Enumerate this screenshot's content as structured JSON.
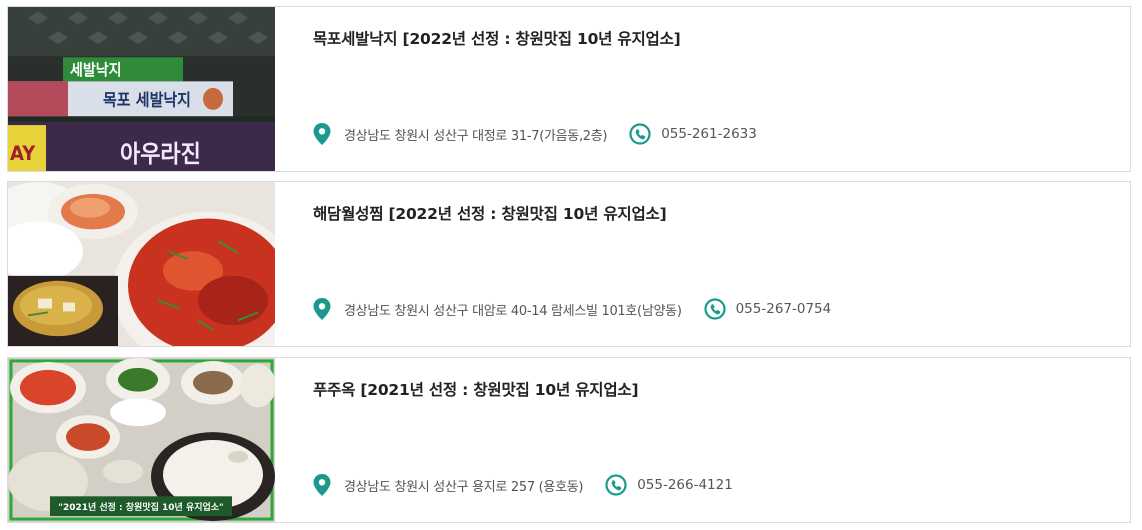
{
  "accent_color": "#1a9a8a",
  "restaurants": [
    {
      "title": "목포세발낙지 [2022년 선정 : 창원맛집 10년 유지업소]",
      "address": "경상남도 창원시 성산구 대정로 31-7(가음동,2층)",
      "phone": "055-261-2633",
      "photo": {
        "signs": [
          "세발낙지",
          "목포 세발낙지",
          "아우라진",
          "AY"
        ]
      }
    },
    {
      "title": "해담월성찜 [2022년 선정 : 창원맛집 10년 유지업소]",
      "address": "경상남도 창원시 성산구 대암로 40-14 람세스빌 101호(남양동)",
      "phone": "055-267-0754"
    },
    {
      "title": "푸주옥 [2021년 선정 : 창원맛집 10년 유지업소]",
      "address": "경상남도 창원시 성산구 용지로 257 (용호동)",
      "phone": "055-266-4121",
      "photo": {
        "banner": "\"2021년 선정 : 창원맛집 10년 유지업소\""
      }
    }
  ]
}
